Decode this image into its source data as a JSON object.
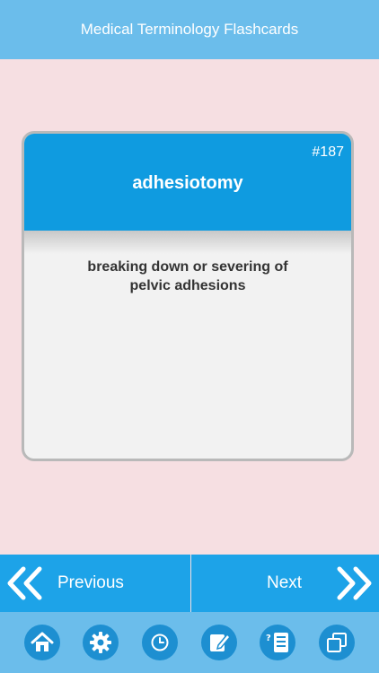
{
  "header": {
    "title": "Medical Terminology Flashcards"
  },
  "card": {
    "number": "#187",
    "term": "adhesiotomy",
    "definition_lines": [
      "breaking down or severing of",
      "pelvic adhesions"
    ]
  },
  "nav": {
    "previous_label": "Previous",
    "next_label": "Next"
  },
  "tabs": [
    {
      "icon": "home-icon"
    },
    {
      "icon": "gear-icon"
    },
    {
      "icon": "clock-icon"
    },
    {
      "icon": "edit-note-icon"
    },
    {
      "icon": "quiz-list-icon"
    },
    {
      "icon": "copy-cards-icon"
    }
  ],
  "colors": {
    "background": "#f6dfe2",
    "header_blue": "#6bbdeb",
    "card_blue": "#0f9be0",
    "nav_blue": "#1da3e8",
    "tab_circle": "#1d8fd1"
  }
}
